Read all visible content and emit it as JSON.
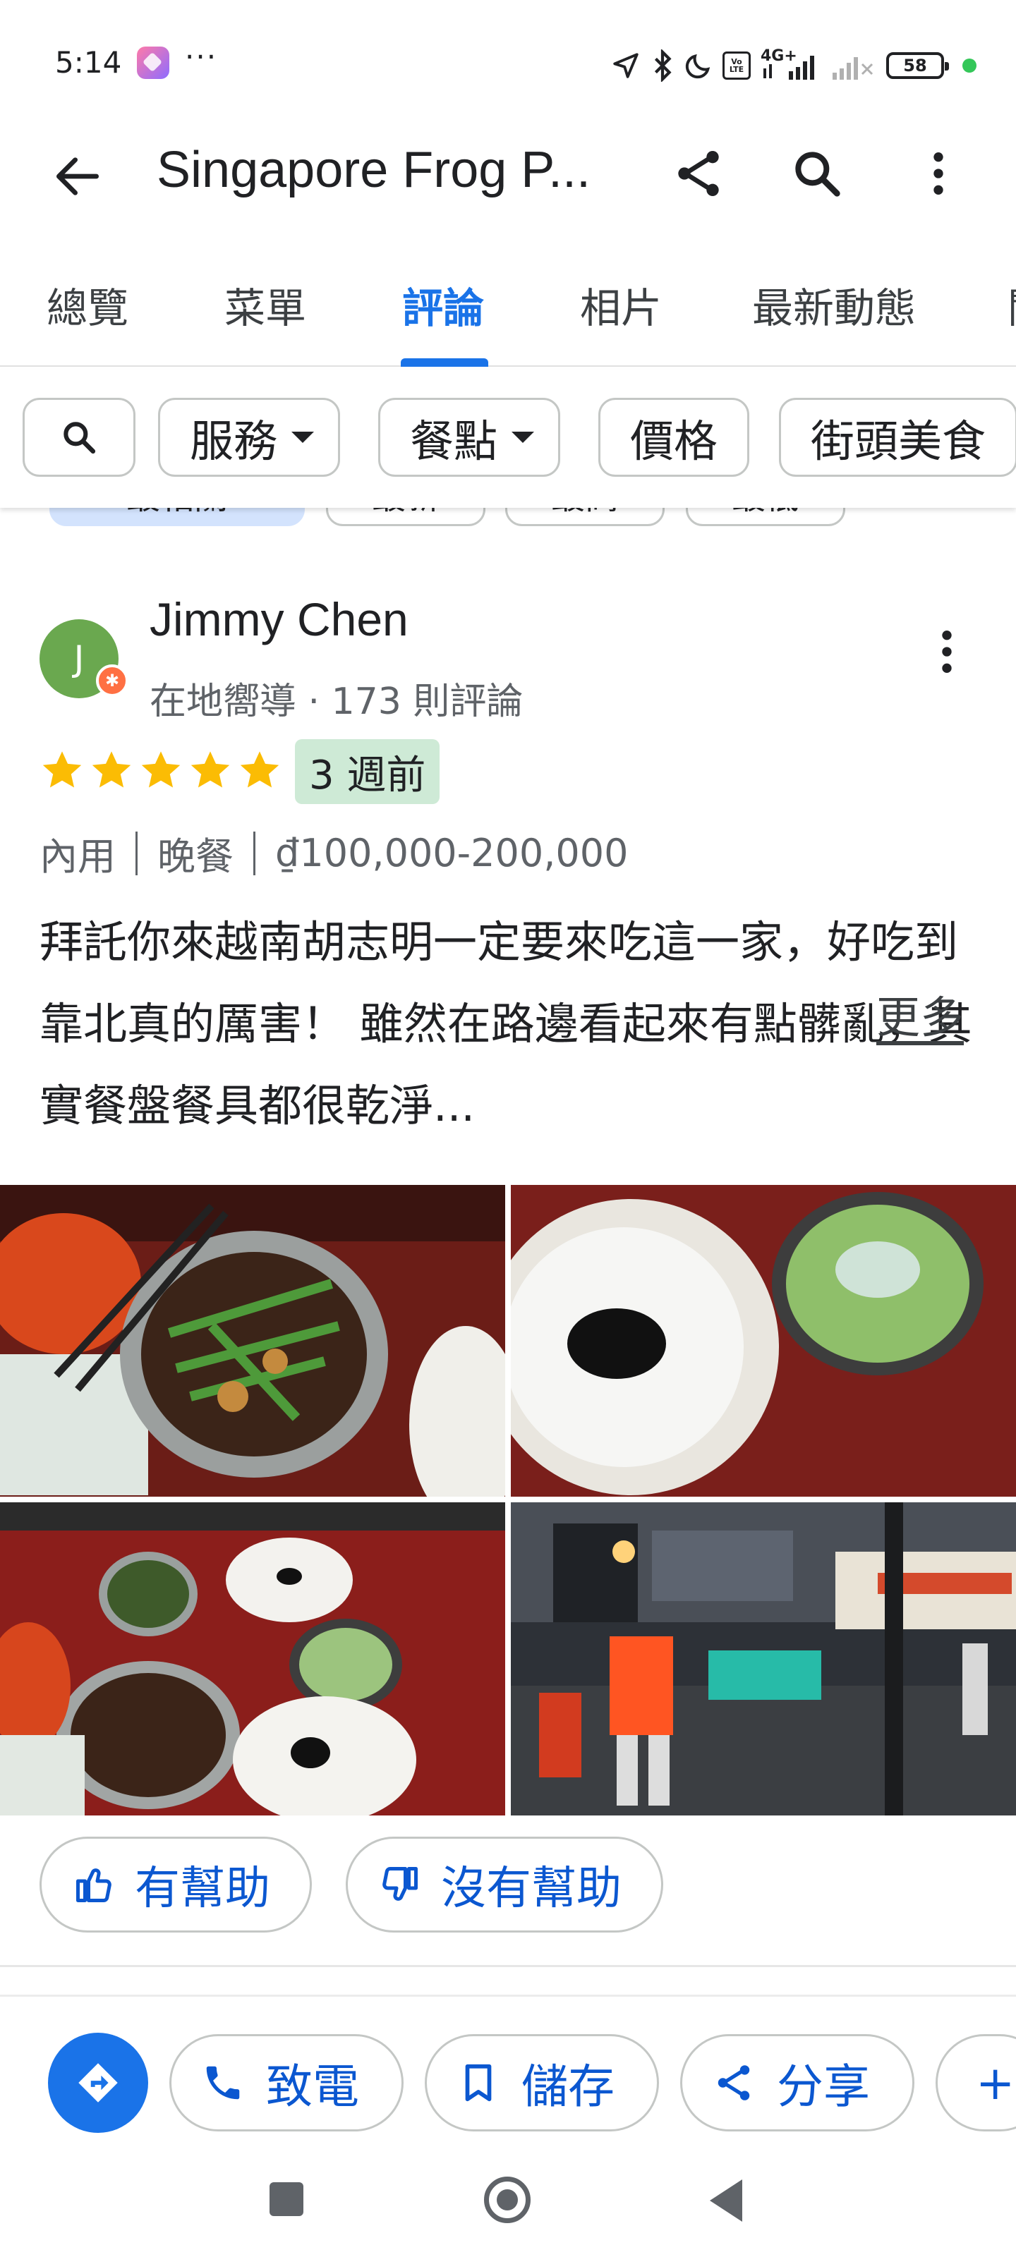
{
  "status_bar": {
    "time": "5:14",
    "overflow": "···",
    "network_label": "4G+",
    "volte_label": "Vo LTE",
    "battery": "58",
    "icons": [
      "app-icon",
      "location-arrow-icon",
      "bluetooth-icon",
      "moon-icon",
      "volte-icon",
      "signal-icon",
      "battery-icon"
    ],
    "dot_color": "#34c759"
  },
  "app_bar": {
    "title": "Singapore Frog P...",
    "icons": [
      "back-arrow-icon",
      "share-icon",
      "search-icon",
      "more-vert-icon"
    ]
  },
  "tabs": [
    {
      "label": "總覽",
      "active": false
    },
    {
      "label": "菜單",
      "active": false
    },
    {
      "label": "評論",
      "active": true
    },
    {
      "label": "相片",
      "active": false
    },
    {
      "label": "最新動態",
      "active": false
    },
    {
      "label": "關",
      "active": false
    }
  ],
  "filters": {
    "search_icon": "search-icon",
    "chips": [
      {
        "label": "服務",
        "dropdown": true
      },
      {
        "label": "餐點",
        "dropdown": true
      },
      {
        "label": "價格",
        "dropdown": false
      },
      {
        "label": "街頭美食",
        "dropdown": false
      }
    ]
  },
  "sort_chips": [
    "最相關",
    "最新",
    "最高",
    "最低"
  ],
  "review": {
    "avatar_letter": "J",
    "avatar_color": "#6aa84f",
    "name": "Jimmy Chen",
    "meta": "在地嚮導 · 173 則評論",
    "rating": 5,
    "time_ago": "3 週前",
    "visit": [
      "內用",
      "晚餐",
      "₫100,000-200,000"
    ],
    "text": "拜託你來越南胡志明一定要來吃這一家，好吃到靠北真的厲害！ 雖然在路邊看起來有點髒亂，其實餐盤餐具都很乾淨...",
    "more": "更多",
    "star_color": "#fbbc04",
    "badge_color": "#ceead6"
  },
  "photos": [
    {
      "description_icon": "frog-clay-pot-photo"
    },
    {
      "description_icon": "congee-bowl-photo"
    },
    {
      "description_icon": "table-spread-photo"
    },
    {
      "description_icon": "street-night-photo"
    }
  ],
  "helpful": {
    "yes": "有幫助",
    "no": "沒有幫助"
  },
  "actions": {
    "call": "致電",
    "save": "儲存",
    "share": "分享",
    "add": "+"
  },
  "accent_color": "#1a73e8"
}
